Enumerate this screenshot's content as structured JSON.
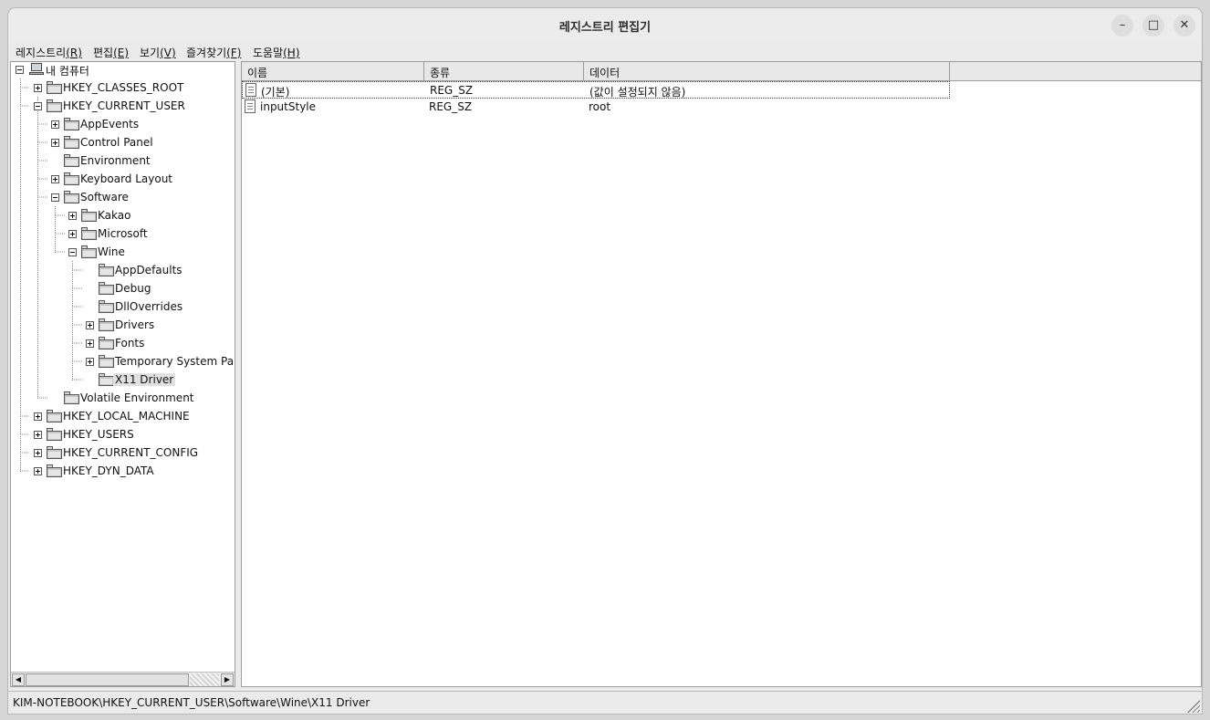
{
  "window": {
    "title": "레지스트리 편집기"
  },
  "menubar": {
    "items": [
      {
        "label": "레지스트리",
        "mnemonic": "(R)"
      },
      {
        "label": "편집",
        "mnemonic": "(E)"
      },
      {
        "label": "보기",
        "mnemonic": "(V)"
      },
      {
        "label": "즐겨찾기",
        "mnemonic": "(F)"
      },
      {
        "label": "도움말",
        "mnemonic": "(H)"
      }
    ]
  },
  "tree": {
    "root": "내 컴퓨터",
    "items": [
      {
        "label": "HKEY_CLASSES_ROOT"
      },
      {
        "label": "HKEY_CURRENT_USER"
      },
      {
        "label": "AppEvents"
      },
      {
        "label": "Control Panel"
      },
      {
        "label": "Environment"
      },
      {
        "label": "Keyboard Layout"
      },
      {
        "label": "Software"
      },
      {
        "label": "Kakao"
      },
      {
        "label": "Microsoft"
      },
      {
        "label": "Wine"
      },
      {
        "label": "AppDefaults"
      },
      {
        "label": "Debug"
      },
      {
        "label": "DllOverrides"
      },
      {
        "label": "Drivers"
      },
      {
        "label": "Fonts"
      },
      {
        "label": "Temporary System Par"
      },
      {
        "label": "X11 Driver"
      },
      {
        "label": "Volatile Environment"
      },
      {
        "label": "HKEY_LOCAL_MACHINE"
      },
      {
        "label": "HKEY_USERS"
      },
      {
        "label": "HKEY_CURRENT_CONFIG"
      },
      {
        "label": "HKEY_DYN_DATA"
      }
    ],
    "selected": "X11 Driver"
  },
  "list": {
    "columns": [
      "이름",
      "종류",
      "데이터"
    ],
    "rows": [
      {
        "name": "(기본)",
        "type": "REG_SZ",
        "data": "(값이 설정되지 않음)"
      },
      {
        "name": "inputStyle",
        "type": "REG_SZ",
        "data": "root"
      }
    ]
  },
  "status": {
    "path": "KIM-NOTEBOOK\\HKEY_CURRENT_USER\\Software\\Wine\\X11 Driver"
  }
}
